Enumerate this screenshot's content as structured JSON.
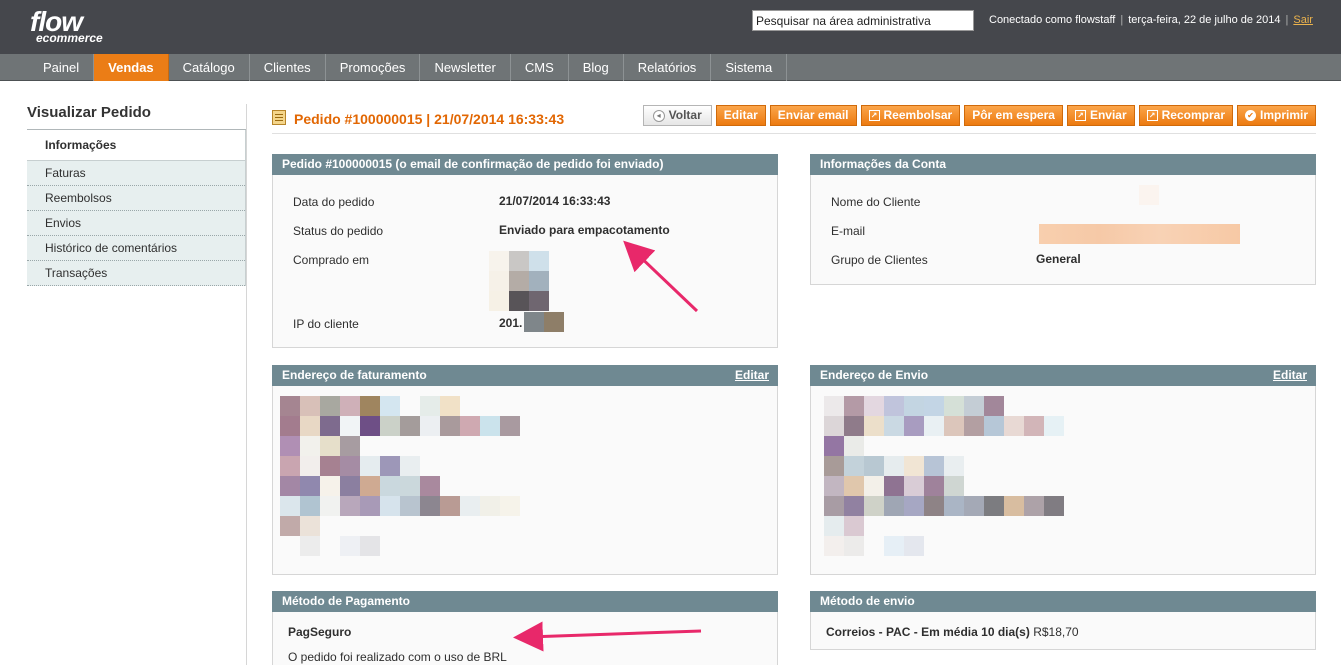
{
  "header": {
    "logo_line1": "flow",
    "logo_line2": "ecommerce",
    "search_value": "Pesquisar na área administrativa",
    "logged_in": "Conectado como flowstaff",
    "date": "terça-feira, 22 de julho de 2014",
    "logout": "Sair"
  },
  "nav": [
    "Painel",
    "Vendas",
    "Catálogo",
    "Clientes",
    "Promoções",
    "Newsletter",
    "CMS",
    "Blog",
    "Relatórios",
    "Sistema"
  ],
  "sidebar": {
    "title": "Visualizar Pedido",
    "tabs": [
      "Informações",
      "Faturas",
      "Reembolsos",
      "Envios",
      "Histórico de comentários",
      "Transações"
    ]
  },
  "page": {
    "title": "Pedido #100000015 | 21/07/2014 16:33:43",
    "buttons": [
      "Voltar",
      "Editar",
      "Enviar email",
      "Reembolsar",
      "Pôr em espera",
      "Enviar",
      "Recomprar",
      "Imprimir"
    ]
  },
  "order_box": {
    "title": "Pedido #100000015 (o email de confirmação de pedido foi enviado)",
    "rows": [
      {
        "label": "Data do pedido",
        "value": "21/07/2014 16:33:43"
      },
      {
        "label": "Status do pedido",
        "value": "Enviado para empacotamento"
      },
      {
        "label": "Comprado em",
        "value": ""
      },
      {
        "label": "IP do cliente",
        "value": "201."
      }
    ]
  },
  "account_box": {
    "title": "Informações da Conta",
    "rows": [
      {
        "label": "Nome do Cliente",
        "value": ""
      },
      {
        "label": "E-mail",
        "value": ""
      },
      {
        "label": "Grupo de Clientes",
        "value": "General"
      }
    ]
  },
  "billing_box": {
    "title": "Endereço de faturamento",
    "edit": "Editar"
  },
  "shipping_box": {
    "title": "Endereço de Envio",
    "edit": "Editar"
  },
  "payment_box": {
    "title": "Método de Pagamento",
    "method": "PagSeguro",
    "note": "O pedido foi realizado com o uso de BRL"
  },
  "shipping_method_box": {
    "title": "Método de envio",
    "method": "Correios - PAC - Em média 10 dia(s)",
    "price": "R$18,70"
  }
}
